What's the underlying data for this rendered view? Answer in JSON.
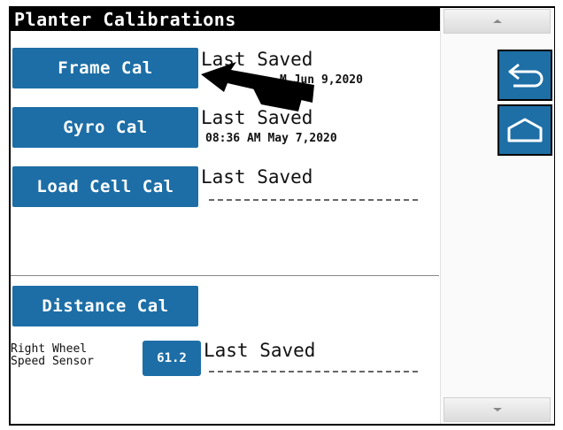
{
  "header": {
    "title": "Planter Calibrations"
  },
  "calibrations": [
    {
      "button": "Frame Cal",
      "last_saved_label": "Last Saved",
      "timestamp": "M Jun  9,2020"
    },
    {
      "button": "Gyro Cal",
      "last_saved_label": "Last Saved",
      "timestamp": "08:36 AM May  7,2020"
    },
    {
      "button": "Load Cell Cal",
      "last_saved_label": "Last Saved",
      "timestamp": ""
    }
  ],
  "distance": {
    "button": "Distance Cal",
    "sensor_label": "Right Wheel\nSpeed Sensor",
    "sensor_value": "61.2",
    "last_saved_label": "Last Saved"
  },
  "side_buttons": {
    "back_icon": "back-arrow-icon",
    "home_icon": "home-icon"
  },
  "colors": {
    "button_blue": "#1d6ea6",
    "title_bg": "#000000"
  }
}
